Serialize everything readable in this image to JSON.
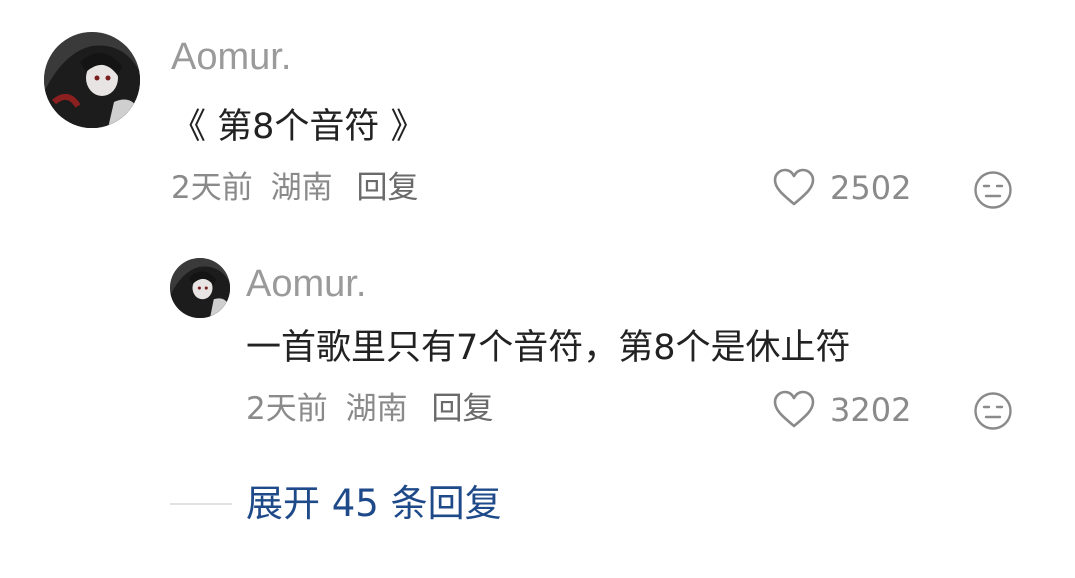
{
  "comment": {
    "username": "Aomur.",
    "text": "《 第8个音符 》",
    "time": "2天前",
    "location": "湖南",
    "reply_label": "回复",
    "likes": "2502"
  },
  "reply": {
    "username": "Aomur.",
    "text": "一首歌里只有7个音符，第8个是休止符",
    "time": "2天前",
    "location": "湖南",
    "reply_label": "回复",
    "likes": "3202"
  },
  "expand": {
    "label": "展开 45 条回复"
  },
  "icons": {
    "like": "heart-outline-icon",
    "dislike": "meh-face-icon"
  },
  "colors": {
    "username": "#9a9a9a",
    "text": "#222222",
    "meta": "#8a8a8a",
    "expand_link": "#1f4a8a"
  }
}
